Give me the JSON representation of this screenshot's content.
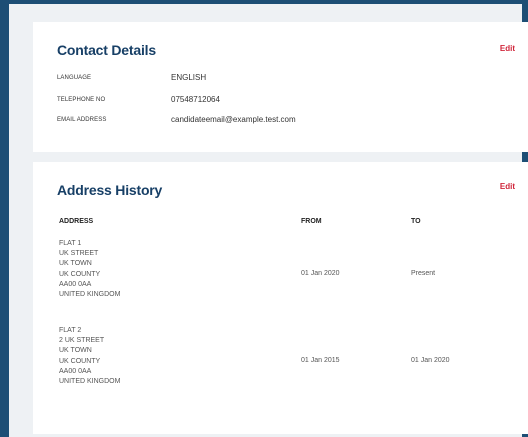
{
  "contact": {
    "title": "Contact Details",
    "edit_label": "Edit",
    "rows": [
      {
        "label": "LANGUAGE",
        "value": "ENGLISH"
      },
      {
        "label": "TELEPHONE NO",
        "value": "07548712064"
      },
      {
        "label": "EMAIL ADDRESS",
        "value": "candidateemail@example.test.com"
      }
    ]
  },
  "address_history": {
    "title": "Address History",
    "edit_label": "Edit",
    "columns": [
      "ADDRESS",
      "FROM",
      "TO"
    ],
    "rows": [
      {
        "lines": [
          "FLAT 1",
          "UK STREET",
          "UK TOWN",
          "UK COUNTY",
          "AA00 0AA",
          "UNITED KINGDOM"
        ],
        "from": "01 Jan 2020",
        "to": "Present"
      },
      {
        "lines": [
          "FLAT 2",
          "2 UK STREET",
          "UK TOWN",
          "UK COUNTY",
          "AA00 0AA",
          "UNITED KINGDOM"
        ],
        "from": "01 Jan 2015",
        "to": "01 Jan 2020"
      }
    ]
  },
  "colors": {
    "frame": "#1d4e75",
    "title": "#173f66",
    "edit": "#d0253a",
    "background": "#eef1f4"
  }
}
